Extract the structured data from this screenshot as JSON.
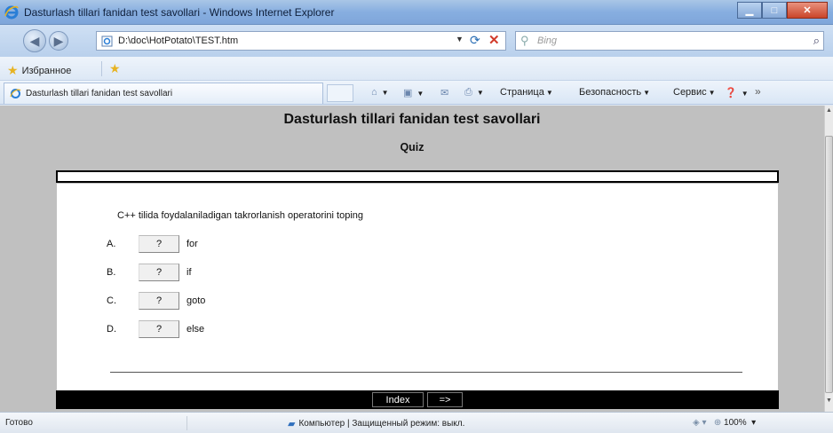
{
  "window": {
    "title": "Dasturlash tillari fanidan test savollari - Windows Internet Explorer"
  },
  "address_bar": {
    "url": "D:\\doc\\HotPotato\\TEST.htm",
    "search_placeholder": "Bing"
  },
  "favorites_bar": {
    "favorites_label": "Избранное"
  },
  "tab": {
    "label": "Dasturlash tillari fanidan test savollari"
  },
  "command_bar": {
    "page_label": "Страница",
    "safety_label": "Безопасность",
    "tools_label": "Сервис"
  },
  "page": {
    "title": "Dasturlash tillari fanidan test savollari",
    "subtitle": "Quiz",
    "question": "C++ tilida foydalaniladigan takrorlanish operatorini toping",
    "answers": [
      {
        "letter": "A.",
        "button": "?",
        "text": "for"
      },
      {
        "letter": "B.",
        "button": "?",
        "text": "if"
      },
      {
        "letter": "C.",
        "button": "?",
        "text": "goto"
      },
      {
        "letter": "D.",
        "button": "?",
        "text": "else"
      }
    ],
    "nav": {
      "index_label": "Index",
      "next_label": "=>"
    }
  },
  "status_bar": {
    "status": "Готово",
    "zone": "Компьютер | Защищенный режим: выкл.",
    "zoom": "100%"
  }
}
